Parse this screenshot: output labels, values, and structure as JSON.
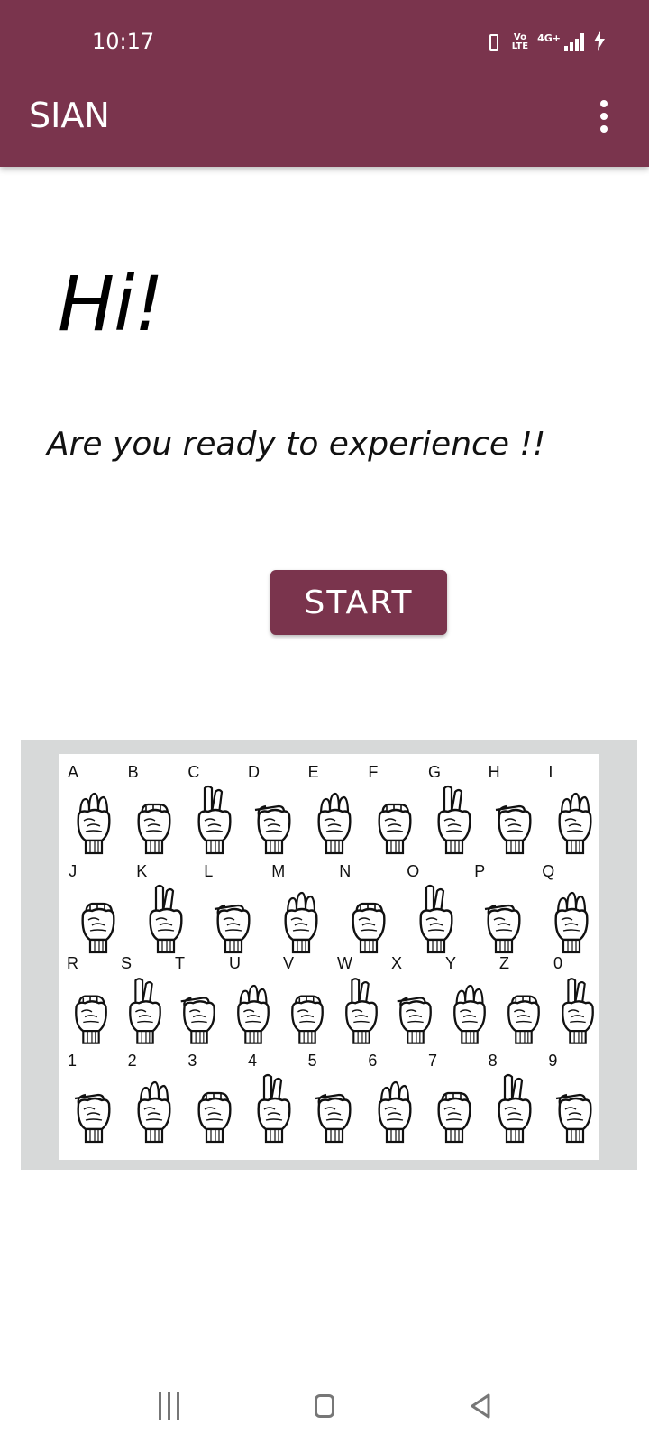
{
  "status_bar": {
    "time": "10:17",
    "volte_top": "Vo",
    "volte_bottom": "LTE",
    "network": "4G+"
  },
  "app_bar": {
    "title": "SIAN",
    "menu_icon": "more-vert-icon"
  },
  "main": {
    "greeting": "Hi!",
    "subtitle": "Are you ready to experience !!",
    "start_label": "START"
  },
  "asl_chart": {
    "letters": [
      "A",
      "B",
      "C",
      "D",
      "E",
      "F",
      "G",
      "H",
      "I",
      "J",
      "K",
      "L",
      "M",
      "N",
      "O",
      "P",
      "Q",
      "R",
      "S",
      "T",
      "U",
      "V",
      "W",
      "X",
      "Y",
      "Z",
      "0",
      "1",
      "2",
      "3",
      "4",
      "5",
      "6",
      "7",
      "8",
      "9"
    ]
  },
  "nav_bar": {
    "icons": [
      "recent-apps-icon",
      "home-icon",
      "back-icon"
    ]
  },
  "colors": {
    "primary": "#7a344d",
    "panel": "#d7d9d9"
  }
}
